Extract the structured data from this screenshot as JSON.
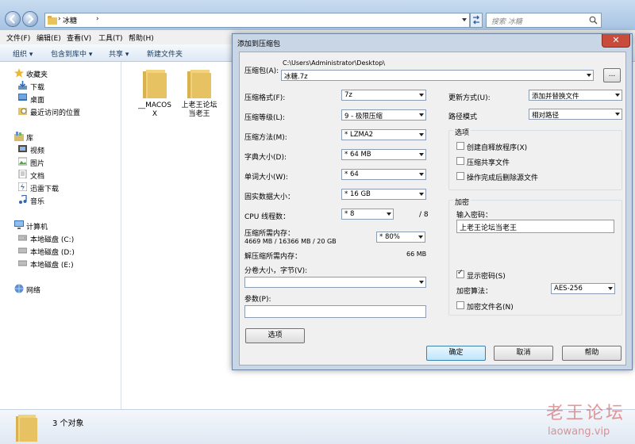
{
  "explorer": {
    "address": "冰糖",
    "search_placeholder": "搜索 冰糖",
    "menu": [
      "文件(F)",
      "编辑(E)",
      "查看(V)",
      "工具(T)",
      "帮助(H)"
    ],
    "commands": [
      "组织 ▾",
      "包含到库中 ▾",
      "共享 ▾",
      "新建文件夹"
    ],
    "nav": {
      "favorites": "收藏夹",
      "favorites_items": [
        "下载",
        "桌面",
        "最近访问的位置"
      ],
      "libraries": "库",
      "library_items": [
        "视频",
        "图片",
        "文档",
        "迅雷下载",
        "音乐"
      ],
      "computer": "计算机",
      "computer_items": [
        "本地磁盘 (C:)",
        "本地磁盘 (D:)",
        "本地磁盘 (E:)"
      ],
      "network": "网络"
    },
    "files": [
      {
        "name": "__MACOS\nX"
      },
      {
        "name": "上老王论坛\n当老王"
      },
      {
        "name": "..."
      }
    ],
    "status": "3 个对象"
  },
  "dialog": {
    "title": "添加到压缩包",
    "close": "✕",
    "archive_label": "压缩包(A):",
    "archive_path": "C:\\Users\\Administrator\\Desktop\\",
    "archive_name": "冰糖.7z",
    "browse": "...",
    "format_label": "压缩格式(F):",
    "format": "7z",
    "level_label": "压缩等级(L):",
    "level": "9 - 极限压缩",
    "method_label": "压缩方法(M):",
    "method": "* LZMA2",
    "dict_label": "字典大小(D):",
    "dict": "* 64 MB",
    "word_label": "单词大小(W):",
    "word": "* 64",
    "solid_label": "固实数据大小：",
    "solid": "* 16 GB",
    "threads_label": "CPU 线程数：",
    "threads": "* 8",
    "threads_max": "/ 8",
    "mem_comp_label": "压缩所需内存：",
    "mem_comp_detail": "4669 MB / 16366 MB / 20 GB",
    "mem_comp": "* 80%",
    "mem_decomp_label": "解压缩所需内存：",
    "mem_decomp": "66 MB",
    "split_label": "分卷大小，字节(V):",
    "params_label": "参数(P):",
    "options_btn": "选项",
    "update_label": "更新方式(U):",
    "update": "添加并替换文件",
    "path_label": "路径模式",
    "path_mode": "相对路径",
    "options_group": "选项",
    "opt_sfx": "创建自释放程序(X)",
    "opt_shared": "压缩共享文件",
    "opt_delete": "操作完成后删除源文件",
    "enc_group": "加密",
    "pwd_label": "输入密码：",
    "pwd": "上老王论坛当老王",
    "show_pwd": "显示密码(S)",
    "enc_method_label": "加密算法：",
    "enc_method": "AES-256",
    "enc_names": "加密文件名(N)",
    "ok": "确定",
    "cancel": "取消",
    "help": "帮助"
  },
  "watermark": {
    "line1": "老王论坛",
    "line2": "laowang.vip"
  }
}
